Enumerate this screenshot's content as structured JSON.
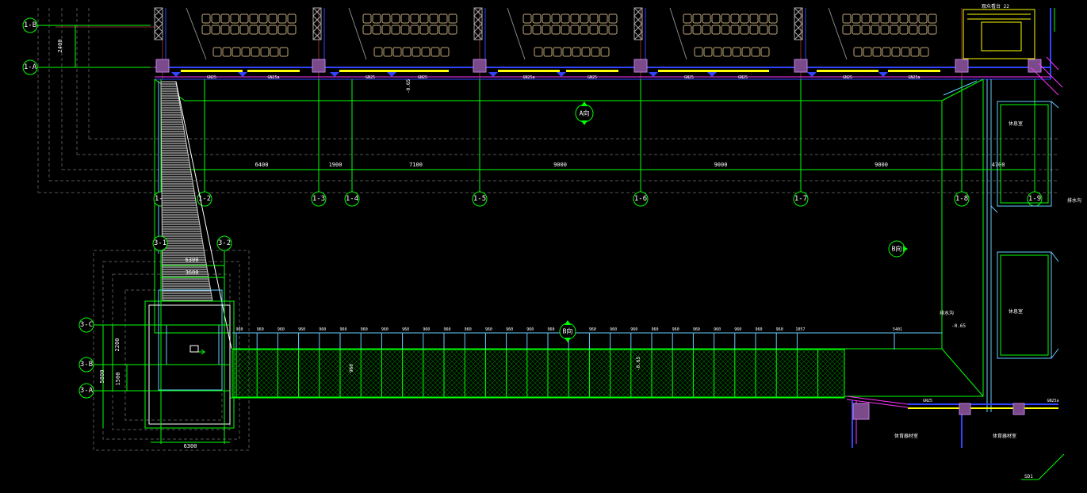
{
  "drawing": {
    "background": "#000000",
    "colors": {
      "axis_line": "#00ff00",
      "axis_bubble": "#00ff00",
      "outline": "#00ff00",
      "wall_blue": "#3344ff",
      "wall_cyan": "#66ccff",
      "grid_dark": "#444444",
      "grid_red": "#803030",
      "dim_white": "#ffffff",
      "column_fill": "#7a4a8a",
      "column_stroke": "#c080e0",
      "magenta": "#ff33ff",
      "yellow": "#ffff00",
      "seats": "#bfa878",
      "crosshatch": "#00aa00",
      "stairs": "#cccccc"
    },
    "axes": {
      "rows": [
        "1-B",
        "1-A"
      ],
      "cols": [
        "1-1",
        "1-2",
        "1-3",
        "1-4",
        "1-5",
        "1-6",
        "1-7",
        "1-8",
        "1-9"
      ],
      "sub_cols": [
        "3-1",
        "3-2"
      ],
      "sub_rows": [
        "3-C",
        "3-B",
        "3-A"
      ]
    },
    "spans": [
      "2400",
      "6400",
      "1900",
      "7100",
      "9000",
      "9000",
      "9000",
      "4700"
    ],
    "dims": {
      "left_vertical": "2400",
      "sub_block_1": "6300",
      "sub_block_2": "3600",
      "sub_vertical_1": "2200",
      "sub_vertical_2": "5800",
      "sub_vertical_3": "1500",
      "sub_bottom": "6300"
    },
    "beams": [
      "GN25",
      "GN25a",
      "GN25",
      "GN25",
      "GN25a",
      "GN25",
      "GN25",
      "GN25",
      "GN25",
      "GN25a"
    ],
    "rail_ticks": [
      "960",
      "960",
      "960",
      "960",
      "960",
      "960",
      "960",
      "960",
      "960",
      "960",
      "960",
      "960",
      "960",
      "960",
      "960",
      "960",
      "960",
      "960",
      "960",
      "960",
      "960",
      "960",
      "960",
      "960",
      "960",
      "960",
      "960",
      "1057",
      "5401"
    ],
    "markers": {
      "a": "A向",
      "b": "B向",
      "c": "B向"
    },
    "notes": {
      "top_right": "观众看台 22",
      "room_1": "休息室",
      "room_2": "休息室",
      "bottom_room_1": "体育器材室",
      "bottom_room_2": "体育器材室",
      "side_right": "排水沟",
      "corner": "SD1",
      "level": "-0.65",
      "top_level": "-0.65",
      "right_level": "-0.65"
    }
  }
}
